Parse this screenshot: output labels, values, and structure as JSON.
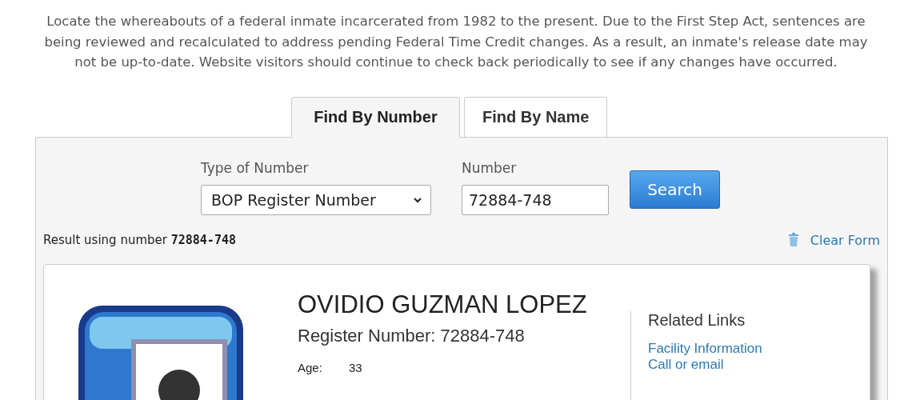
{
  "intro": "Locate the whereabouts of a federal inmate incarcerated from 1982 to the present. Due to the First Step Act, sentences are being reviewed and recalculated to address pending Federal Time Credit changes. As a result, an inmate's release date may not be up-to-date. Website visitors should continue to check back periodically to see if any changes have occurred.",
  "tabs": [
    {
      "label": "Find By Number",
      "selected": true
    },
    {
      "label": "Find By Name",
      "selected": false
    }
  ],
  "form": {
    "type_label": "Type of Number",
    "type_value": "BOP Register Number",
    "number_label": "Number",
    "number_value": "72884-748",
    "search_button": "Search"
  },
  "result": {
    "text": "Result using number **72884-748**",
    "clear": "Clear Form"
  },
  "inmate": {
    "name": "OVIDIO GUZMAN LOPEZ",
    "register": "Register Number: 72884-748",
    "age_label": "Age:",
    "age": "33"
  },
  "related": {
    "title": "Related Links",
    "links": [
      "Facility Information",
      "Call or email"
    ]
  }
}
